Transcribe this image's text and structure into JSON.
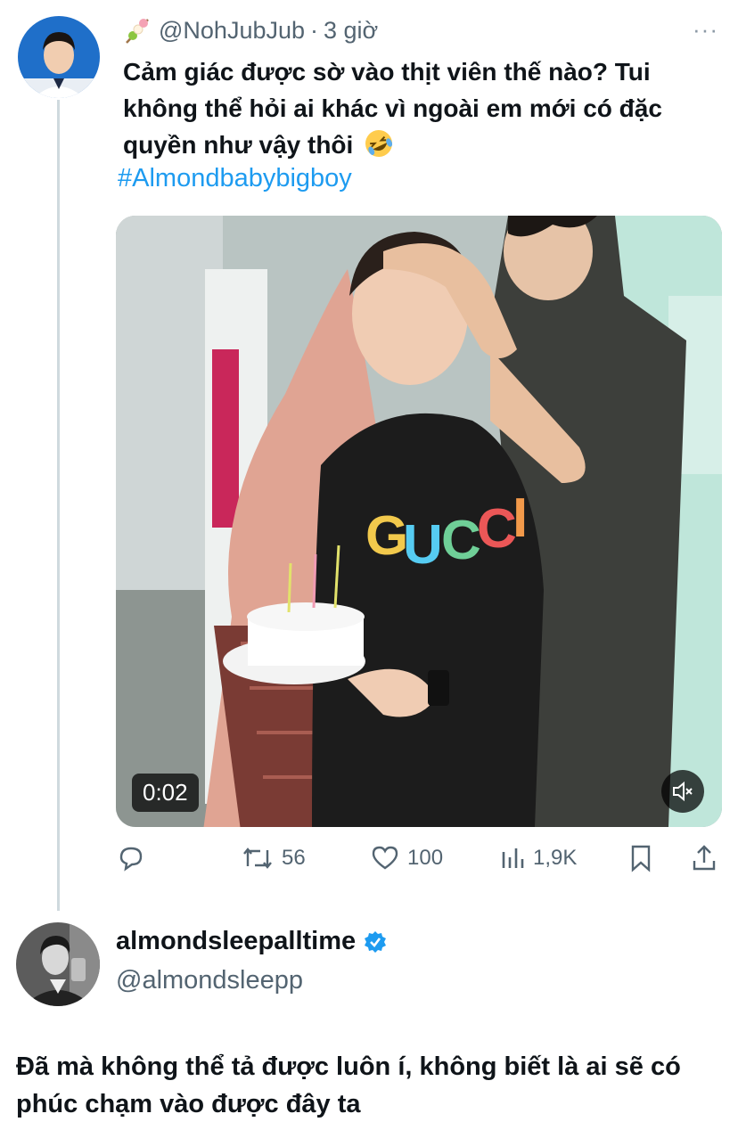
{
  "tweet": {
    "handle": "@NohJubJub",
    "separator": "·",
    "time": "3 giờ",
    "more_icon": "ellipsis-icon",
    "text": "Cảm giác được sờ vào thịt viên thế nào? Tui không thể hỏi ai khác vì ngoài em mới có đặc quyền như vậy thôi",
    "text_emoji": "rolling-on-floor-laughing-emoji",
    "hashtag": "#Almondbabybigboy",
    "video": {
      "duration": "0:02",
      "muted": true
    }
  },
  "actions": {
    "reply_count": "",
    "retweet_count": "56",
    "like_count": "100",
    "views_count": "1,9K"
  },
  "reply": {
    "display_name": "almondsleepalltime",
    "verified": true,
    "handle": "@almondsleepp",
    "text": "Đã mà không thể tả được luôn í, không biết là ai sẽ có phúc chạm vào được đây ta"
  },
  "colors": {
    "accent": "#1d9bf0",
    "muted_text": "#536471",
    "text": "#0f1419",
    "thread_line": "#cfd9de"
  }
}
